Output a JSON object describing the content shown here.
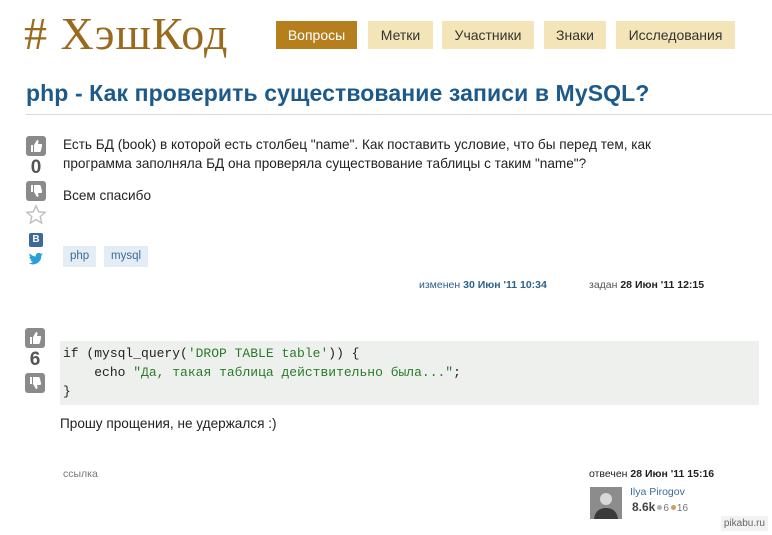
{
  "site": {
    "logo": "# ХэшКод"
  },
  "nav": [
    {
      "label": "Вопросы",
      "active": true
    },
    {
      "label": "Метки",
      "active": false
    },
    {
      "label": "Участники",
      "active": false
    },
    {
      "label": "Знаки",
      "active": false
    },
    {
      "label": "Исследования",
      "active": false
    }
  ],
  "question": {
    "title": "php - Как проверить существование записи в MySQL?",
    "vote_count": "0",
    "body_line1": "Есть БД (book) в которой есть столбец \"name\". Как поставить условие, что бы перед тем, как",
    "body_line2": "программа заполняла БД она проверяла существование таблицы с таким \"name\"?",
    "body_thanks": "Всем спасибо",
    "tags": [
      "php",
      "mysql"
    ],
    "edited_label": "изменен",
    "edited_date": "30 Июн '11 10:34",
    "asked_label": "задан",
    "asked_date": "28 Июн '11 12:15"
  },
  "answer": {
    "vote_count": "6",
    "code": {
      "line1_kw": "if",
      "line1_rest": " (mysql_query(",
      "line1_str": "'DROP TABLE table'",
      "line1_end": ")) {",
      "line2_kw": "echo",
      "line2_str": "\"Да, такая таблица действительно была...\"",
      "line2_end": ";",
      "line3": "}"
    },
    "text": "Прошу прощения, не удержался :)",
    "share_label": "ссылка",
    "answered_label": "отвечен",
    "answered_date": "28 Июн '11 15:16",
    "user": {
      "name": "Ilya Pirogov",
      "rep": "8.6k",
      "silver": "6",
      "bronze": "16"
    }
  },
  "colors": {
    "accent": "#b57f1e",
    "nav_bg": "#f3e5b8",
    "title": "#1d5a8c",
    "tag_bg": "#e4edf5",
    "silver": "#b0b0b0",
    "bronze": "#c8a060"
  },
  "watermark": "pikabu.ru"
}
